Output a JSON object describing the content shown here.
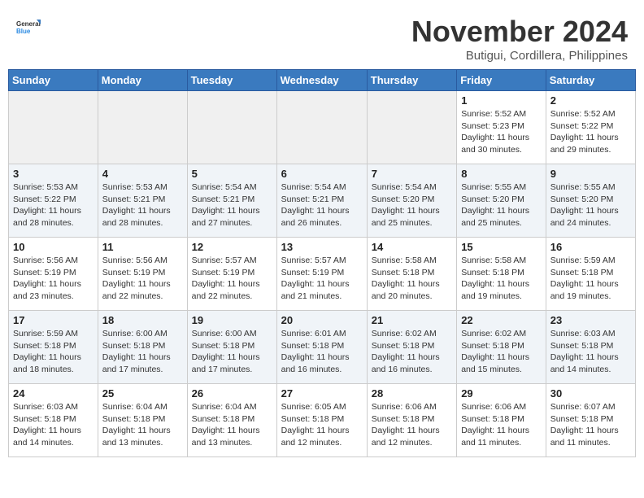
{
  "logo": {
    "general": "General",
    "blue": "Blue"
  },
  "header": {
    "month": "November 2024",
    "location": "Butigui, Cordillera, Philippines"
  },
  "weekdays": [
    "Sunday",
    "Monday",
    "Tuesday",
    "Wednesday",
    "Thursday",
    "Friday",
    "Saturday"
  ],
  "weeks": [
    [
      {
        "day": "",
        "sunrise": "",
        "sunset": "",
        "daylight": ""
      },
      {
        "day": "",
        "sunrise": "",
        "sunset": "",
        "daylight": ""
      },
      {
        "day": "",
        "sunrise": "",
        "sunset": "",
        "daylight": ""
      },
      {
        "day": "",
        "sunrise": "",
        "sunset": "",
        "daylight": ""
      },
      {
        "day": "",
        "sunrise": "",
        "sunset": "",
        "daylight": ""
      },
      {
        "day": "1",
        "sunrise": "Sunrise: 5:52 AM",
        "sunset": "Sunset: 5:23 PM",
        "daylight": "Daylight: 11 hours and 30 minutes."
      },
      {
        "day": "2",
        "sunrise": "Sunrise: 5:52 AM",
        "sunset": "Sunset: 5:22 PM",
        "daylight": "Daylight: 11 hours and 29 minutes."
      }
    ],
    [
      {
        "day": "3",
        "sunrise": "Sunrise: 5:53 AM",
        "sunset": "Sunset: 5:22 PM",
        "daylight": "Daylight: 11 hours and 28 minutes."
      },
      {
        "day": "4",
        "sunrise": "Sunrise: 5:53 AM",
        "sunset": "Sunset: 5:21 PM",
        "daylight": "Daylight: 11 hours and 28 minutes."
      },
      {
        "day": "5",
        "sunrise": "Sunrise: 5:54 AM",
        "sunset": "Sunset: 5:21 PM",
        "daylight": "Daylight: 11 hours and 27 minutes."
      },
      {
        "day": "6",
        "sunrise": "Sunrise: 5:54 AM",
        "sunset": "Sunset: 5:21 PM",
        "daylight": "Daylight: 11 hours and 26 minutes."
      },
      {
        "day": "7",
        "sunrise": "Sunrise: 5:54 AM",
        "sunset": "Sunset: 5:20 PM",
        "daylight": "Daylight: 11 hours and 25 minutes."
      },
      {
        "day": "8",
        "sunrise": "Sunrise: 5:55 AM",
        "sunset": "Sunset: 5:20 PM",
        "daylight": "Daylight: 11 hours and 25 minutes."
      },
      {
        "day": "9",
        "sunrise": "Sunrise: 5:55 AM",
        "sunset": "Sunset: 5:20 PM",
        "daylight": "Daylight: 11 hours and 24 minutes."
      }
    ],
    [
      {
        "day": "10",
        "sunrise": "Sunrise: 5:56 AM",
        "sunset": "Sunset: 5:19 PM",
        "daylight": "Daylight: 11 hours and 23 minutes."
      },
      {
        "day": "11",
        "sunrise": "Sunrise: 5:56 AM",
        "sunset": "Sunset: 5:19 PM",
        "daylight": "Daylight: 11 hours and 22 minutes."
      },
      {
        "day": "12",
        "sunrise": "Sunrise: 5:57 AM",
        "sunset": "Sunset: 5:19 PM",
        "daylight": "Daylight: 11 hours and 22 minutes."
      },
      {
        "day": "13",
        "sunrise": "Sunrise: 5:57 AM",
        "sunset": "Sunset: 5:19 PM",
        "daylight": "Daylight: 11 hours and 21 minutes."
      },
      {
        "day": "14",
        "sunrise": "Sunrise: 5:58 AM",
        "sunset": "Sunset: 5:18 PM",
        "daylight": "Daylight: 11 hours and 20 minutes."
      },
      {
        "day": "15",
        "sunrise": "Sunrise: 5:58 AM",
        "sunset": "Sunset: 5:18 PM",
        "daylight": "Daylight: 11 hours and 19 minutes."
      },
      {
        "day": "16",
        "sunrise": "Sunrise: 5:59 AM",
        "sunset": "Sunset: 5:18 PM",
        "daylight": "Daylight: 11 hours and 19 minutes."
      }
    ],
    [
      {
        "day": "17",
        "sunrise": "Sunrise: 5:59 AM",
        "sunset": "Sunset: 5:18 PM",
        "daylight": "Daylight: 11 hours and 18 minutes."
      },
      {
        "day": "18",
        "sunrise": "Sunrise: 6:00 AM",
        "sunset": "Sunset: 5:18 PM",
        "daylight": "Daylight: 11 hours and 17 minutes."
      },
      {
        "day": "19",
        "sunrise": "Sunrise: 6:00 AM",
        "sunset": "Sunset: 5:18 PM",
        "daylight": "Daylight: 11 hours and 17 minutes."
      },
      {
        "day": "20",
        "sunrise": "Sunrise: 6:01 AM",
        "sunset": "Sunset: 5:18 PM",
        "daylight": "Daylight: 11 hours and 16 minutes."
      },
      {
        "day": "21",
        "sunrise": "Sunrise: 6:02 AM",
        "sunset": "Sunset: 5:18 PM",
        "daylight": "Daylight: 11 hours and 16 minutes."
      },
      {
        "day": "22",
        "sunrise": "Sunrise: 6:02 AM",
        "sunset": "Sunset: 5:18 PM",
        "daylight": "Daylight: 11 hours and 15 minutes."
      },
      {
        "day": "23",
        "sunrise": "Sunrise: 6:03 AM",
        "sunset": "Sunset: 5:18 PM",
        "daylight": "Daylight: 11 hours and 14 minutes."
      }
    ],
    [
      {
        "day": "24",
        "sunrise": "Sunrise: 6:03 AM",
        "sunset": "Sunset: 5:18 PM",
        "daylight": "Daylight: 11 hours and 14 minutes."
      },
      {
        "day": "25",
        "sunrise": "Sunrise: 6:04 AM",
        "sunset": "Sunset: 5:18 PM",
        "daylight": "Daylight: 11 hours and 13 minutes."
      },
      {
        "day": "26",
        "sunrise": "Sunrise: 6:04 AM",
        "sunset": "Sunset: 5:18 PM",
        "daylight": "Daylight: 11 hours and 13 minutes."
      },
      {
        "day": "27",
        "sunrise": "Sunrise: 6:05 AM",
        "sunset": "Sunset: 5:18 PM",
        "daylight": "Daylight: 11 hours and 12 minutes."
      },
      {
        "day": "28",
        "sunrise": "Sunrise: 6:06 AM",
        "sunset": "Sunset: 5:18 PM",
        "daylight": "Daylight: 11 hours and 12 minutes."
      },
      {
        "day": "29",
        "sunrise": "Sunrise: 6:06 AM",
        "sunset": "Sunset: 5:18 PM",
        "daylight": "Daylight: 11 hours and 11 minutes."
      },
      {
        "day": "30",
        "sunrise": "Sunrise: 6:07 AM",
        "sunset": "Sunset: 5:18 PM",
        "daylight": "Daylight: 11 hours and 11 minutes."
      }
    ]
  ]
}
